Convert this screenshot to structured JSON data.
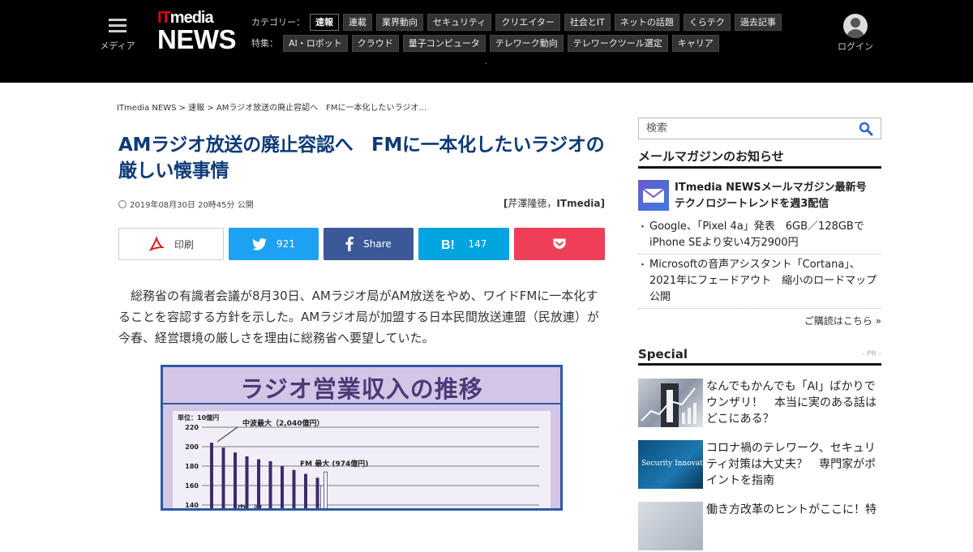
{
  "header": {
    "menu_label": "メディア",
    "logo_it_red": "IT",
    "logo_it_white": "media",
    "logo_news": "NEWS",
    "category_heading": "カテゴリー：",
    "categories": [
      "速報",
      "連載",
      "業界動向",
      "セキュリティ",
      "クリエイター",
      "社会とIT",
      "ネットの話題",
      "くらテク",
      "過去記事"
    ],
    "feature_heading": "特集：",
    "features": [
      "AI・ロボット",
      "クラウド",
      "量子コンピュータ",
      "テレワーク動向",
      "テレワークツール選定",
      "キャリア"
    ],
    "dot": "·",
    "login_label": "ログイン"
  },
  "article": {
    "breadcrumb": "ITmedia NEWS > 速報 > AMラジオ放送の廃止容認へ　FMに一本化したいラジオ…",
    "title": "AMラジオ放送の廃止容認へ　FMに一本化したいラジオの厳しい懐事情",
    "date": "2019年08月30日 20時45分 公開",
    "author_bracket_open": "[",
    "author_name": "芹澤隆徳，",
    "author_org": "ITmedia",
    "author_bracket_close": "]",
    "body": "総務省の有識者会議が8月30日、AMラジオ局がAM放送をやめ、ワイドFMに一本化することを容認する方針を示した。AMラジオ局が加盟する日本民間放送連盟（民放連）が今春、経営環境の厳しさを理由に総務省へ要望していた。"
  },
  "share": {
    "print_label": "印刷",
    "twitter_count": "921",
    "facebook_label": "Share",
    "hatena_count": "147",
    "accent_twitter": "#1da1f2",
    "accent_facebook": "#3b5998",
    "accent_hatena": "#00a4de",
    "accent_pocket": "#ef3f56"
  },
  "figure": {
    "title": "ラジオ営業収入の推移",
    "unit_label": "単位：10億円",
    "annotation_am": "中波最大（2,040億円）",
    "annotation_fm": "FM 最大 (974億円)",
    "series_label_am": "中　波"
  },
  "chart_data": {
    "type": "bar",
    "title": "ラジオ営業収入の推移",
    "ylabel": "単位：10億円",
    "y_ticks": [
      "220",
      "200",
      "180",
      "160",
      "140"
    ],
    "ylim": [
      130,
      220
    ],
    "series": [
      {
        "name": "中　波",
        "values": [
          204,
          199,
          194,
          190,
          187,
          185,
          180,
          176,
          172,
          168
        ]
      },
      {
        "name": "FM",
        "values": [
          null,
          null,
          null,
          null,
          null,
          null,
          null,
          null,
          160,
          174
        ]
      }
    ]
  },
  "sidebar": {
    "search_placeholder": "検索",
    "mailmag_heading": "メールマガジンのお知らせ",
    "mailmag_feature_line1": "ITmedia NEWSメールマガジン最新号",
    "mailmag_feature_line2": "テクノロジートレンドを週3配信",
    "mailmag_items": [
      "Google、「Pixel 4a」発表　6GB／128GBでiPhone SEより安い4万2900円",
      "Microsoftの音声アシスタント「Cortana」、2021年にフェードアウト　縮小のロードマップ公開"
    ],
    "mailmag_more": "ご購読はこちら »",
    "special_heading": "Special",
    "special_pr": "- PR -",
    "special_items": [
      "なんでもかんでも「AI」ばかりでウンザリ！　本当に実のある話はどこにある？",
      "コロナ禍のテレワーク、セキュリティ対策は大丈夫？　専門家がポイントを指南",
      "働き方改革のヒントがここに！特"
    ],
    "special_thumb2_text": "Security Innovation"
  }
}
